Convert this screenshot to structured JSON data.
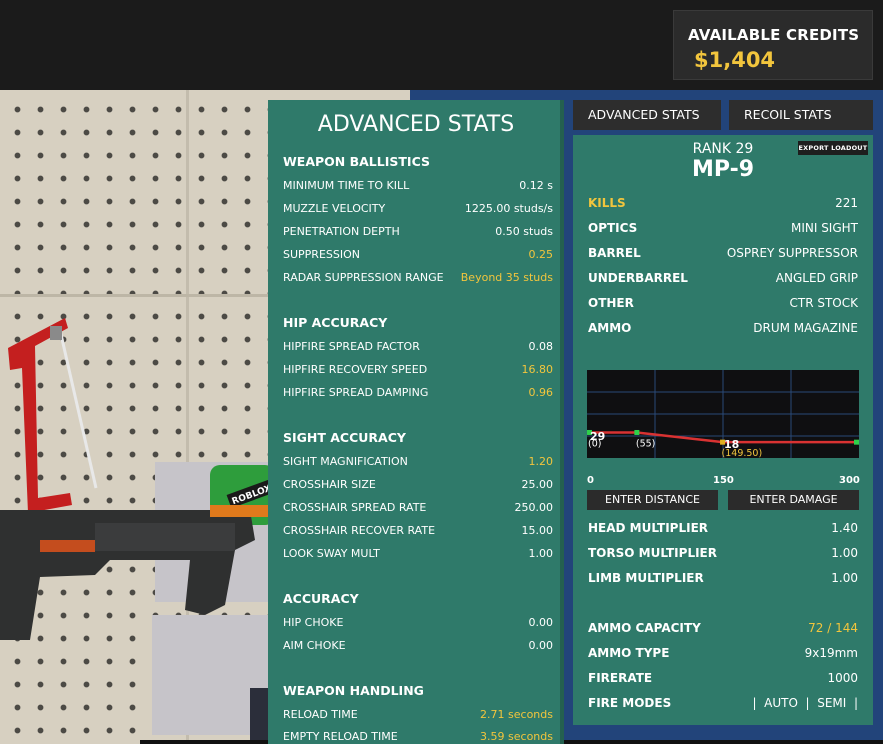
{
  "credits": {
    "label": "AVAILABLE CREDITS",
    "amount": "$1,404"
  },
  "advanced": {
    "title": "ADVANCED STATS",
    "sections": [
      {
        "heading": "WEAPON BALLISTICS",
        "rows": [
          {
            "label": "MINIMUM TIME TO KILL",
            "value": "0.12 s",
            "highlight": false
          },
          {
            "label": "MUZZLE VELOCITY",
            "value": "1225.00 studs/s",
            "highlight": false
          },
          {
            "label": "PENETRATION DEPTH",
            "value": "0.50 studs",
            "highlight": false
          },
          {
            "label": "SUPPRESSION",
            "value": "0.25",
            "highlight": true
          },
          {
            "label": "RADAR SUPPRESSION RANGE",
            "value": "Beyond 35 studs",
            "highlight": true
          }
        ]
      },
      {
        "heading": "HIP ACCURACY",
        "rows": [
          {
            "label": "HIPFIRE SPREAD FACTOR",
            "value": "0.08",
            "highlight": false
          },
          {
            "label": "HIPFIRE RECOVERY SPEED",
            "value": "16.80",
            "highlight": true
          },
          {
            "label": "HIPFIRE SPREAD DAMPING",
            "value": "0.96",
            "highlight": true
          }
        ]
      },
      {
        "heading": "SIGHT ACCURACY",
        "rows": [
          {
            "label": "SIGHT MAGNIFICATION",
            "value": "1.20",
            "highlight": true
          },
          {
            "label": "CROSSHAIR SIZE",
            "value": "25.00",
            "highlight": false
          },
          {
            "label": "CROSSHAIR SPREAD RATE",
            "value": "250.00",
            "highlight": false
          },
          {
            "label": "CROSSHAIR RECOVER RATE",
            "value": "15.00",
            "highlight": false
          },
          {
            "label": "LOOK SWAY MULT",
            "value": "1.00",
            "highlight": false
          }
        ]
      },
      {
        "heading": "ACCURACY",
        "rows": [
          {
            "label": "HIP CHOKE",
            "value": "0.00",
            "highlight": false
          },
          {
            "label": "AIM CHOKE",
            "value": "0.00",
            "highlight": false
          }
        ]
      },
      {
        "heading": "WEAPON HANDLING",
        "rows": [
          {
            "label": "RELOAD TIME",
            "value": "2.71 seconds",
            "highlight": true
          },
          {
            "label": "EMPTY RELOAD TIME",
            "value": "3.59 seconds",
            "highlight": true
          }
        ]
      }
    ]
  },
  "tabs": [
    {
      "label": "ADVANCED STATS"
    },
    {
      "label": "RECOIL STATS"
    }
  ],
  "weapon": {
    "rank": "RANK 29",
    "name": "MP-9",
    "export_label": "EXPORT LOADOUT",
    "kills": {
      "label": "KILLS",
      "value": "221"
    },
    "attachments": [
      {
        "label": "OPTICS",
        "value": "MINI SIGHT"
      },
      {
        "label": "BARREL",
        "value": "OSPREY SUPPRESSOR"
      },
      {
        "label": "UNDERBARREL",
        "value": "ANGLED GRIP"
      },
      {
        "label": "OTHER",
        "value": "CTR STOCK"
      },
      {
        "label": "AMMO",
        "value": "DRUM MAGAZINE"
      }
    ],
    "damage_graph": {
      "axis_labels": [
        "0",
        "150",
        "300"
      ],
      "max_damage": "29",
      "min_damage": "18",
      "points": [
        {
          "distance": 0,
          "damage": 29,
          "label": "(0)"
        },
        {
          "distance": 55,
          "damage": 29,
          "label": "(55)"
        },
        {
          "distance": 149.5,
          "damage": 18,
          "label": "(149.50)"
        },
        {
          "distance": 300,
          "damage": 18,
          "label": ""
        }
      ]
    },
    "buttons": {
      "distance": "ENTER DISTANCE",
      "damage": "ENTER DAMAGE"
    },
    "multipliers": [
      {
        "label": "HEAD MULTIPLIER",
        "value": "1.40"
      },
      {
        "label": "TORSO MULTIPLIER",
        "value": "1.00"
      },
      {
        "label": "LIMB MULTIPLIER",
        "value": "1.00"
      }
    ],
    "ammo_capacity": {
      "label": "AMMO CAPACITY",
      "value": "72 / 144"
    },
    "ammo_type": {
      "label": "AMMO TYPE",
      "value": "9x19mm"
    },
    "firerate": {
      "label": "FIRERATE",
      "value": "1000"
    },
    "fire_modes": {
      "label": "FIRE MODES",
      "value": "|  AUTO  |  SEMI  |"
    }
  },
  "scene": {
    "sticker_text": "ROBLOX"
  }
}
